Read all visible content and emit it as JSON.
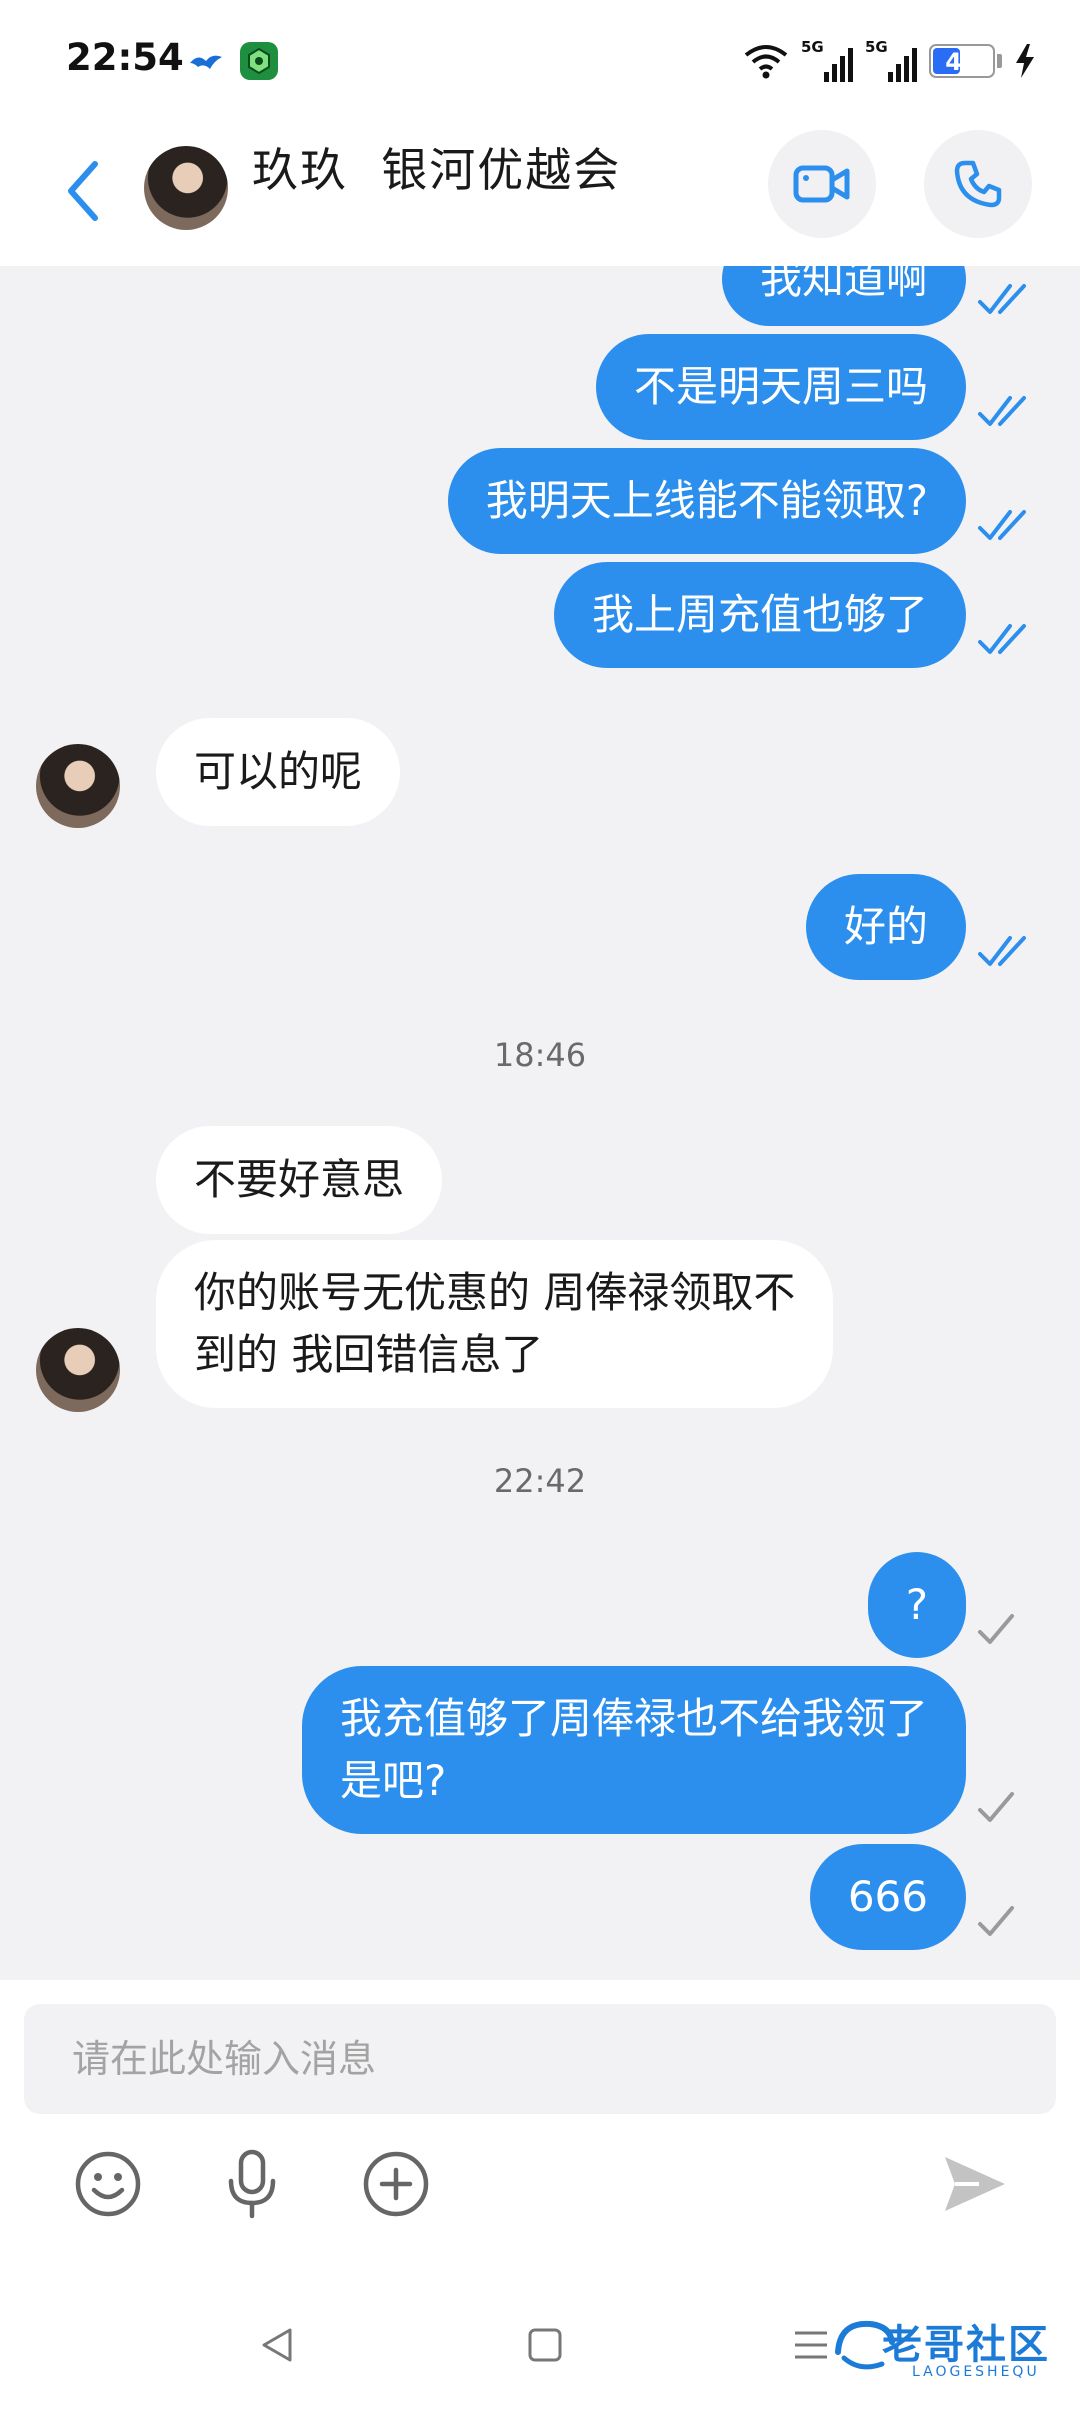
{
  "status_bar": {
    "time": "22:54",
    "network_tags": [
      "5G",
      "5G"
    ],
    "battery_level": "47",
    "battery_fraction": 0.47
  },
  "header": {
    "back_icon": "chevron-left-icon",
    "title": "玖玖  银河优越会",
    "video_call_icon": "video-camera-icon",
    "voice_call_icon": "phone-icon"
  },
  "messages": [
    {
      "direction": "out",
      "text": "我知道啊",
      "status": "read"
    },
    {
      "direction": "out",
      "text": "不是明天周三吗",
      "status": "read"
    },
    {
      "direction": "out",
      "text": "我明天上线能不能领取?",
      "status": "read"
    },
    {
      "direction": "out",
      "text": "我上周充值也够了",
      "status": "read"
    },
    {
      "direction": "in",
      "text": "可以的呢"
    },
    {
      "direction": "out",
      "text": "好的",
      "status": "read"
    },
    {
      "type": "time",
      "text": "18:46"
    },
    {
      "direction": "in",
      "text": "不要好意思"
    },
    {
      "direction": "in",
      "text": "你的账号无优惠的 周俸禄领取不\n到的 我回错信息了"
    },
    {
      "type": "time",
      "text": "22:42"
    },
    {
      "direction": "out",
      "text": "?",
      "status": "sent"
    },
    {
      "direction": "out",
      "text": "我充值够了周俸禄也不给我领了\n是吧?",
      "status": "sent"
    },
    {
      "direction": "out",
      "text": "666",
      "status": "sent"
    }
  ],
  "composer": {
    "placeholder": "请在此处输入消息",
    "tools": [
      "emoji-icon",
      "microphone-icon",
      "add-icon"
    ],
    "send_icon": "send-icon"
  },
  "watermark": {
    "main": "老哥社区",
    "sub": "LAOGESHEQU"
  },
  "colors": {
    "outgoing_bubble": "#2d8fed",
    "incoming_bubble": "#ffffff",
    "read_tick": "#2d8fed",
    "sent_tick": "#9a9a9a",
    "background": "#f2f2f4"
  }
}
